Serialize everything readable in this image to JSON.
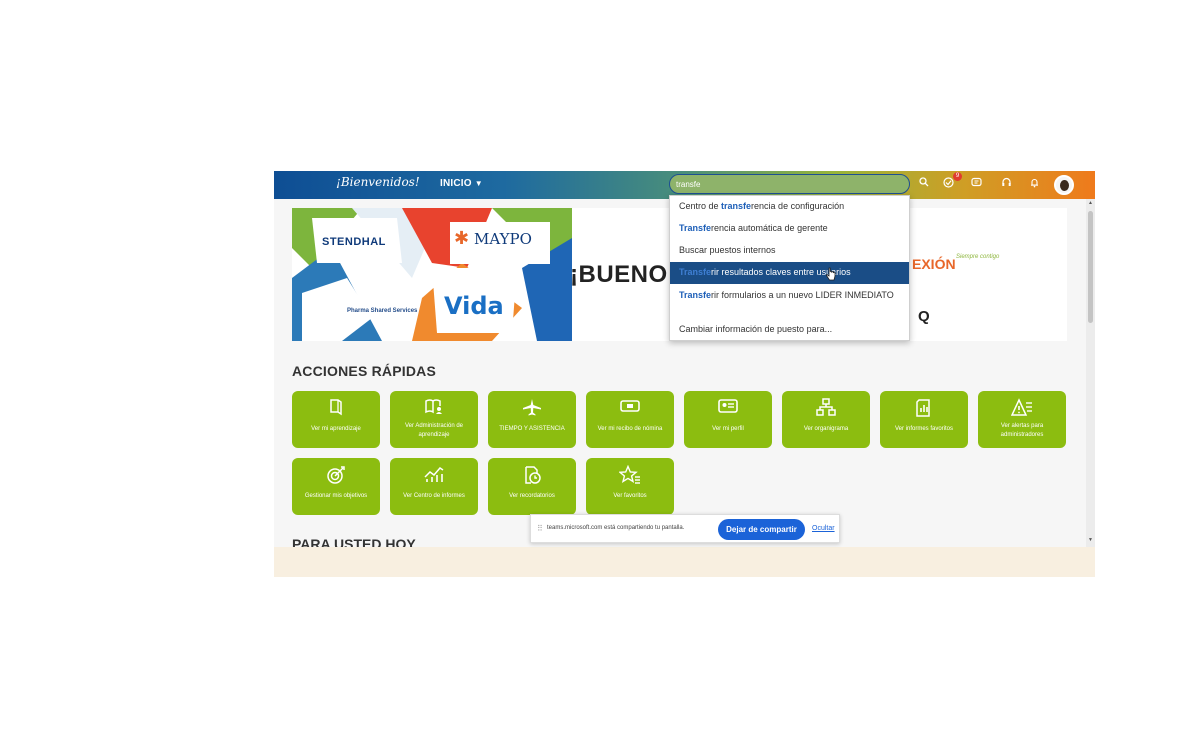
{
  "topbar": {
    "brand": "¡Bienvenidos!",
    "nav_label": "INICIO",
    "search_value": "transfe",
    "notification_count": "9"
  },
  "banner": {
    "welcome_text": "¡BUENO",
    "brands": [
      "STENDHAL",
      "MAYPO",
      "Vida",
      "Pharma Shared Services"
    ],
    "right_text": "EXIÓN",
    "right_sub": "Siempre contigo",
    "right_letter": "Q"
  },
  "search_results": [
    {
      "pre": "Centro de ",
      "match": "transfe",
      "post": "rencia de configuración"
    },
    {
      "pre": "",
      "match": "Transfe",
      "post": "rencia automática de gerente"
    },
    {
      "pre": "Buscar puestos internos",
      "match": "",
      "post": ""
    },
    {
      "pre": "",
      "match": "Transfe",
      "post": "rir resultados claves entre usuarios"
    },
    {
      "pre": "",
      "match": "Transfe",
      "post": "rir formularios a un nuevo LIDER INMEDIATO"
    },
    {
      "pre": "Cambiar información de puesto para...",
      "match": "",
      "post": ""
    }
  ],
  "quick_actions": {
    "title": "ACCIONES RÁPIDAS",
    "tiles": [
      {
        "label": "Ver mi aprendizaje",
        "icon": "book-icon"
      },
      {
        "label": "Ver Administración de aprendizaje",
        "icon": "book-admin-icon"
      },
      {
        "label": "TIEMPO Y ASISTENCIA",
        "icon": "airplane-icon"
      },
      {
        "label": "Ver mi recibo de nómina",
        "icon": "money-icon"
      },
      {
        "label": "Ver mi perfil",
        "icon": "id-card-icon"
      },
      {
        "label": "Ver organigrama",
        "icon": "org-chart-icon"
      },
      {
        "label": "Ver informes favoritos",
        "icon": "report-icon"
      },
      {
        "label": "Ver alertas para administradores",
        "icon": "alert-icon"
      },
      {
        "label": "Gestionar mis objetivos",
        "icon": "target-icon"
      },
      {
        "label": "Ver Centro de informes",
        "icon": "chart-icon"
      },
      {
        "label": "Ver recordatorios",
        "icon": "reminder-icon"
      },
      {
        "label": "Ver favoritos",
        "icon": "star-icon"
      }
    ]
  },
  "section2_title": "PARA USTED HOY",
  "sharebar": {
    "message": "teams.microsoft.com está compartiendo tu pantalla.",
    "stop_label": "Dejar de compartir",
    "hide_label": "Ocultar"
  }
}
